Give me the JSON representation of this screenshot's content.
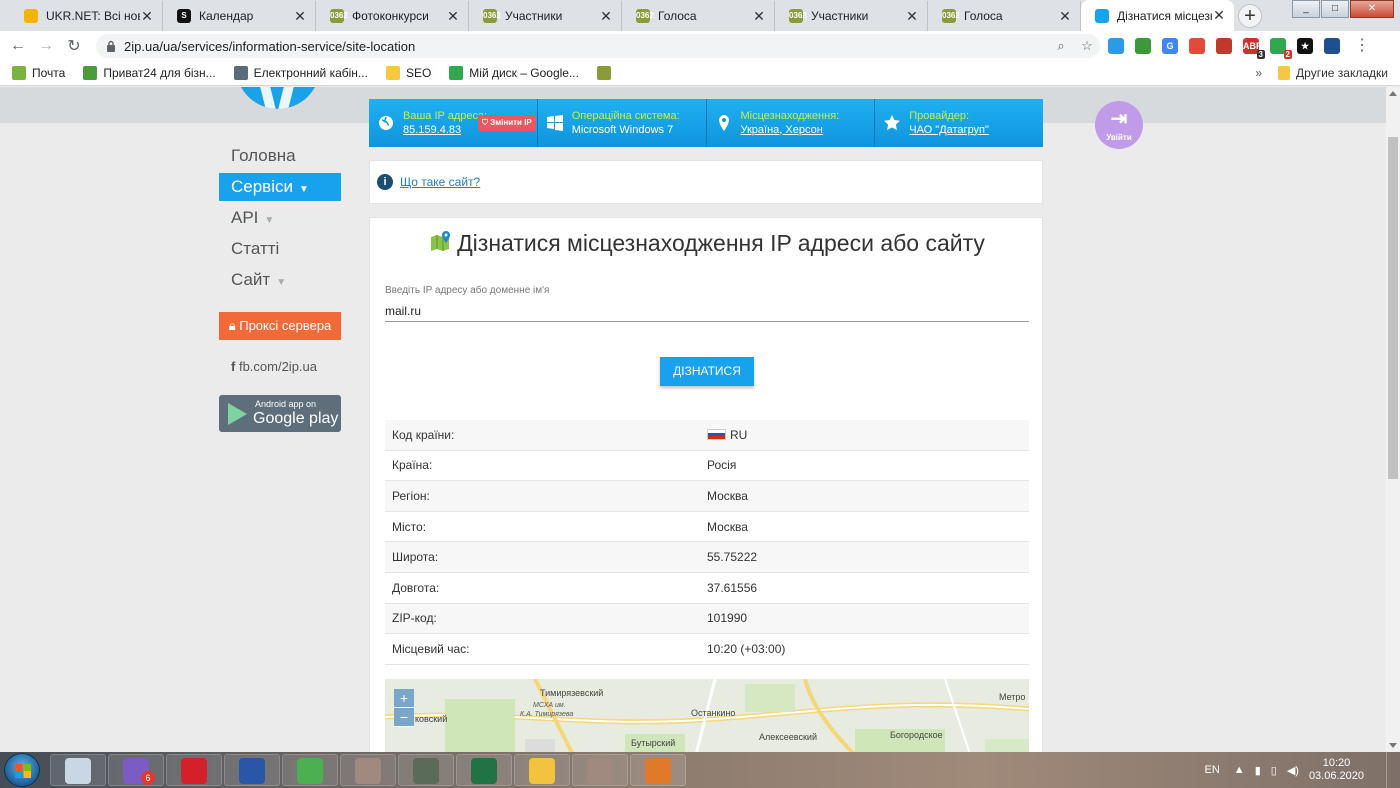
{
  "browser": {
    "tabs": [
      {
        "title": "UKR.NET: Всі новини",
        "fav": "#f5b400",
        "favtext": ""
      },
      {
        "title": "Календар",
        "fav": "#111111",
        "favtext": "S"
      },
      {
        "title": "Фотоконкурси",
        "fav": "#8a9b3c",
        "favtext": "0362"
      },
      {
        "title": "Участники",
        "fav": "#8a9b3c",
        "favtext": "0362"
      },
      {
        "title": "Голоса",
        "fav": "#8a9b3c",
        "favtext": "0362"
      },
      {
        "title": "Участники",
        "fav": "#8a9b3c",
        "favtext": "0362"
      },
      {
        "title": "Голоса",
        "fav": "#8a9b3c",
        "favtext": "0362"
      },
      {
        "title": "Дізнатися місцезнах",
        "fav": "#18a2ed",
        "favtext": ""
      }
    ],
    "url": "2ip.ua/ua/services/information-service/site-location",
    "extensions": [
      {
        "color": "#2b9be8",
        "text": "",
        "count": ""
      },
      {
        "color": "#3a9a3a",
        "text": "",
        "count": ""
      },
      {
        "color": "#4285f4",
        "text": "G",
        "count": ""
      },
      {
        "color": "#e04b3a",
        "text": "",
        "count": ""
      },
      {
        "color": "#c0392b",
        "text": "",
        "count": ""
      },
      {
        "color": "#d32f2f",
        "text": "ABP",
        "count": "3"
      },
      {
        "color": "#2fa84f",
        "text": "",
        "count": "2"
      },
      {
        "color": "#111111",
        "text": "★",
        "count": ""
      },
      {
        "color": "#1d4f91",
        "text": "",
        "count": ""
      }
    ],
    "bookmarks": [
      {
        "label": "Почта",
        "color": "#7bb342"
      },
      {
        "label": "Приват24 для бізн...",
        "color": "#4a9b3a"
      },
      {
        "label": "Електронний кабін...",
        "color": "#5a6b7c"
      },
      {
        "label": "SEO",
        "color": "#f6c842"
      },
      {
        "label": "Мій диск – Google...",
        "color": "#2fa84f"
      },
      {
        "label": "",
        "color": "#8a9b3c"
      }
    ],
    "other_bookmarks": "Другие закладки",
    "more": "»"
  },
  "infobar": {
    "ip": {
      "label": "Ваша IP адреса:",
      "value": "85.159.4.83",
      "change_button": "Змінити IP"
    },
    "os": {
      "label": "Операційна система:",
      "value": "Microsoft Windows 7"
    },
    "location": {
      "label": "Місцезнаходження:",
      "value": "Україна, Херсон"
    },
    "provider": {
      "label": "Провайдер:",
      "value": "ЧАО \"Датагруп\""
    }
  },
  "login_label": "Увійти",
  "sidenav": [
    {
      "label": "Головна",
      "chevron": false,
      "active": false
    },
    {
      "label": "Сервіси",
      "chevron": true,
      "active": true
    },
    {
      "label": "API",
      "chevron": true,
      "active": false
    },
    {
      "label": "Статті",
      "chevron": false,
      "active": false
    },
    {
      "label": "Сайт",
      "chevron": true,
      "active": false
    }
  ],
  "proxy_button": "Проксі сервера",
  "facebook_link": "fb.com/2ip.ua",
  "google_play": {
    "line1": "Android app on",
    "line2": "Google play"
  },
  "what_site_link": "Що таке сайт?",
  "main": {
    "title": "Дізнатися місцезнаходження IP адреси або сайту",
    "input_label": "Введіть IP адресу або доменне ім'я",
    "input_value": "mail.ru",
    "submit_label": "ДІЗНАТИСЯ"
  },
  "results": [
    {
      "key": "Код країни:",
      "value": "RU",
      "flag": true
    },
    {
      "key": "Країна:",
      "value": "Росія",
      "flag": false
    },
    {
      "key": "Регіон:",
      "value": "Москва",
      "flag": false
    },
    {
      "key": "Місто:",
      "value": "Москва",
      "flag": false
    },
    {
      "key": "Широта:",
      "value": "55.75222",
      "flag": false
    },
    {
      "key": "Довгота:",
      "value": "37.61556",
      "flag": false
    },
    {
      "key": "ZIP-код:",
      "value": "101990",
      "flag": false
    },
    {
      "key": "Місцевий час:",
      "value": "10:20 (+03:00)",
      "flag": false
    }
  ],
  "map": {
    "labels": [
      {
        "text": "Тимирязевский",
        "it": false
      },
      {
        "text": "МСХА им.",
        "it": true
      },
      {
        "text": "К.А. Тимирязева",
        "it": true
      },
      {
        "text": "Останкино",
        "it": false
      },
      {
        "text": "Алексеевский",
        "it": false
      },
      {
        "text": "Богородское",
        "it": false
      },
      {
        "text": "Бутырский",
        "it": false
      },
      {
        "text": "Метро",
        "it": false
      },
      {
        "text": "ковский",
        "it": false
      }
    ],
    "zoom_in": "+",
    "zoom_out": "−"
  },
  "taskbar": {
    "apps": [
      {
        "color": "#c9d6e3",
        "badge": ""
      },
      {
        "color": "#7b5cc4",
        "badge": "6"
      },
      {
        "color": "#d4202a",
        "badge": ""
      },
      {
        "color": "#2a56a8",
        "badge": ""
      },
      {
        "color": "#4caf50",
        "badge": ""
      },
      {
        "color": "#a08a80",
        "badge": ""
      },
      {
        "color": "#5a6b5a",
        "badge": ""
      },
      {
        "color": "#217346",
        "badge": ""
      },
      {
        "color": "#f3c33f",
        "badge": ""
      },
      {
        "color": "#a08a80",
        "badge": ""
      },
      {
        "color": "#e07a2a",
        "badge": ""
      }
    ],
    "lang": "EN",
    "time": "10:20",
    "date": "03.06.2020"
  }
}
